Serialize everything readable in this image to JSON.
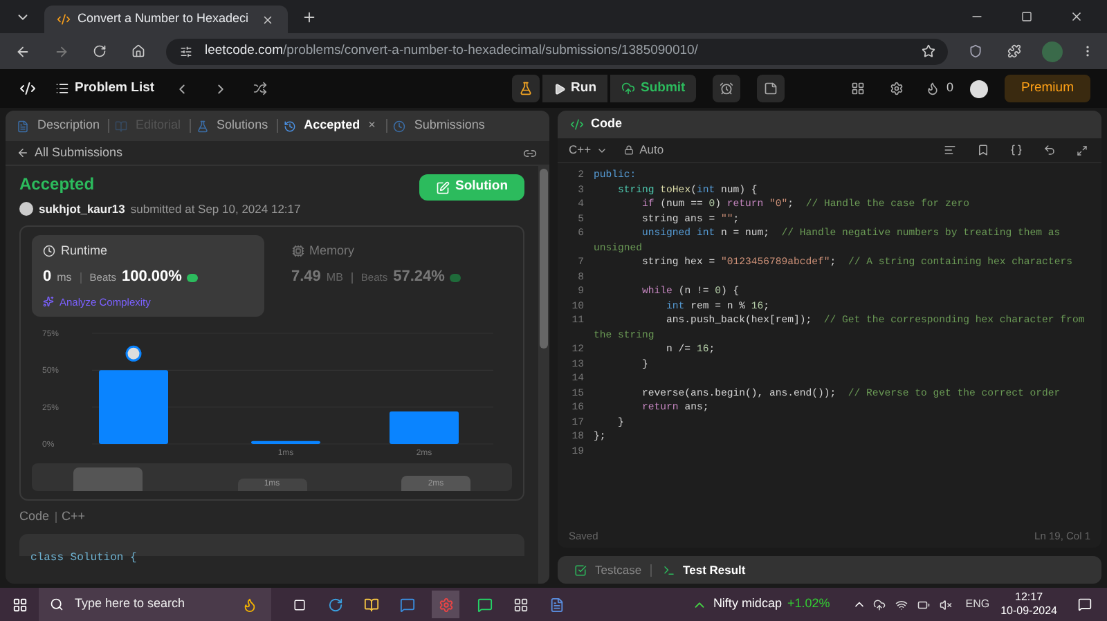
{
  "browser": {
    "tab_title": "Convert a Number to Hexadeci",
    "url_host": "leetcode.com",
    "url_path": "/problems/convert-a-number-to-hexadecimal/submissions/1385090010/"
  },
  "nav": {
    "problem_list": "Problem List",
    "run": "Run",
    "submit": "Submit",
    "streak": "0",
    "premium": "Premium"
  },
  "left_tabs": [
    {
      "label": "Description",
      "selected": false,
      "disabled": false,
      "closable": false
    },
    {
      "label": "Editorial",
      "selected": false,
      "disabled": true,
      "closable": false
    },
    {
      "label": "Solutions",
      "selected": false,
      "disabled": false,
      "closable": false
    },
    {
      "label": "Accepted",
      "selected": true,
      "disabled": false,
      "closable": true
    },
    {
      "label": "Submissions",
      "selected": false,
      "disabled": false,
      "closable": false
    }
  ],
  "close_glyph": "×",
  "back_link": "All Submissions",
  "submission": {
    "status": "Accepted",
    "user": "sukhjot_kaur13",
    "submitted": "submitted at Sep 10, 2024 12:17",
    "solution_button": "Solution"
  },
  "stats": [
    {
      "kind": "runtime",
      "title": "Runtime",
      "value": "0",
      "unit": "ms",
      "beats_label": "Beats",
      "beats": "100.00%",
      "analyze": "Analyze Complexity",
      "selected": true
    },
    {
      "kind": "memory",
      "title": "Memory",
      "value": "7.49",
      "unit": "MB",
      "beats_label": "Beats",
      "beats": "57.24%",
      "selected": false
    }
  ],
  "chart_data": {
    "type": "bar",
    "categories": [
      null,
      "1ms",
      "2ms"
    ],
    "values": [
      50,
      2,
      22
    ],
    "yticks": [
      {
        "value": 0,
        "label": "0%"
      },
      {
        "value": 25,
        "label": "25%"
      },
      {
        "value": 50,
        "label": "50%"
      },
      {
        "value": 75,
        "label": "75%"
      }
    ],
    "ylim": [
      0,
      75
    ]
  },
  "navigator_labels": [
    "1ms",
    "2ms"
  ],
  "code_section": {
    "title": "Code",
    "language": "C++",
    "preview": "class Solution {"
  },
  "editor": {
    "title": "Code",
    "language": "C++",
    "mode": "Auto",
    "status": "Saved",
    "cursor": "Ln 19, Col 1",
    "lines": [
      {
        "number": "2",
        "segments": [
          {
            "kind": "keyword",
            "text": "public:"
          }
        ]
      },
      {
        "number": "3",
        "segments": [
          {
            "kind": "type",
            "text": "    string"
          },
          {
            "kind": "function",
            "text": " toHex"
          },
          {
            "kind": "plain",
            "text": "("
          },
          {
            "kind": "keyword",
            "text": "int"
          },
          {
            "kind": "plain",
            "text": " num) {"
          }
        ]
      },
      {
        "number": "4",
        "segments": [
          {
            "kind": "control",
            "text": "        if"
          },
          {
            "kind": "plain",
            "text": " (num == "
          },
          {
            "kind": "number",
            "text": "0"
          },
          {
            "kind": "plain",
            "text": ") "
          },
          {
            "kind": "control",
            "text": "return"
          },
          {
            "kind": "string",
            "text": " \"0\""
          },
          {
            "kind": "plain",
            "text": ";  "
          },
          {
            "kind": "comment",
            "text": "// Handle the case for zero"
          }
        ]
      },
      {
        "number": "5",
        "segments": [
          {
            "kind": "plain",
            "text": "        string ans = "
          },
          {
            "kind": "string",
            "text": "\"\""
          },
          {
            "kind": "plain",
            "text": ";"
          }
        ]
      },
      {
        "number": "6",
        "segments": [
          {
            "kind": "keyword",
            "text": "        unsigned int"
          },
          {
            "kind": "plain",
            "text": " n = num;  "
          },
          {
            "kind": "comment",
            "text": "// Handle negative numbers by treating them as unsigned"
          }
        ]
      },
      {
        "number": "7",
        "segments": [
          {
            "kind": "plain",
            "text": "        string hex = "
          },
          {
            "kind": "string",
            "text": "\"0123456789abcdef\""
          },
          {
            "kind": "plain",
            "text": ";  "
          },
          {
            "kind": "comment",
            "text": "// A string containing hex characters"
          }
        ]
      },
      {
        "number": "8"
      },
      {
        "number": "9",
        "segments": [
          {
            "kind": "control",
            "text": "        while"
          },
          {
            "kind": "plain",
            "text": " (n != "
          },
          {
            "kind": "number",
            "text": "0"
          },
          {
            "kind": "plain",
            "text": ") {"
          }
        ]
      },
      {
        "number": "10",
        "segments": [
          {
            "kind": "keyword",
            "text": "            int"
          },
          {
            "kind": "plain",
            "text": " rem = n % "
          },
          {
            "kind": "number",
            "text": "16"
          },
          {
            "kind": "plain",
            "text": ";"
          }
        ]
      },
      {
        "number": "11",
        "segments": [
          {
            "kind": "plain",
            "text": "            ans.push_back(hex[rem]);  "
          },
          {
            "kind": "comment",
            "text": "// Get the corresponding hex character from the string"
          }
        ]
      },
      {
        "number": "12",
        "segments": [
          {
            "kind": "plain",
            "text": "            n /= "
          },
          {
            "kind": "number",
            "text": "16"
          },
          {
            "kind": "plain",
            "text": ";"
          }
        ]
      },
      {
        "number": "13",
        "segments": [
          {
            "kind": "plain",
            "text": "        }"
          }
        ]
      },
      {
        "number": "14"
      },
      {
        "number": "15",
        "segments": [
          {
            "kind": "plain",
            "text": "        reverse(ans.begin(), ans.end());  "
          },
          {
            "kind": "comment",
            "text": "// Reverse to get the correct order"
          }
        ]
      },
      {
        "number": "16",
        "segments": [
          {
            "kind": "control",
            "text": "        return"
          },
          {
            "kind": "plain",
            "text": " ans;"
          }
        ]
      },
      {
        "number": "17",
        "segments": [
          {
            "kind": "plain",
            "text": "    }"
          }
        ]
      },
      {
        "number": "18",
        "segments": [
          {
            "kind": "plain",
            "text": "};"
          }
        ]
      },
      {
        "number": "19"
      }
    ]
  },
  "bottom_tabs": [
    {
      "label": "Testcase",
      "selected": false
    },
    {
      "label": "Test Result",
      "selected": true
    }
  ],
  "taskbar": {
    "search_placeholder": "Type here to search",
    "ticker": "Nifty midcap",
    "ticker_change": "+1.02%",
    "language": "ENG",
    "time": "12:17",
    "date": "10-09-2024"
  }
}
